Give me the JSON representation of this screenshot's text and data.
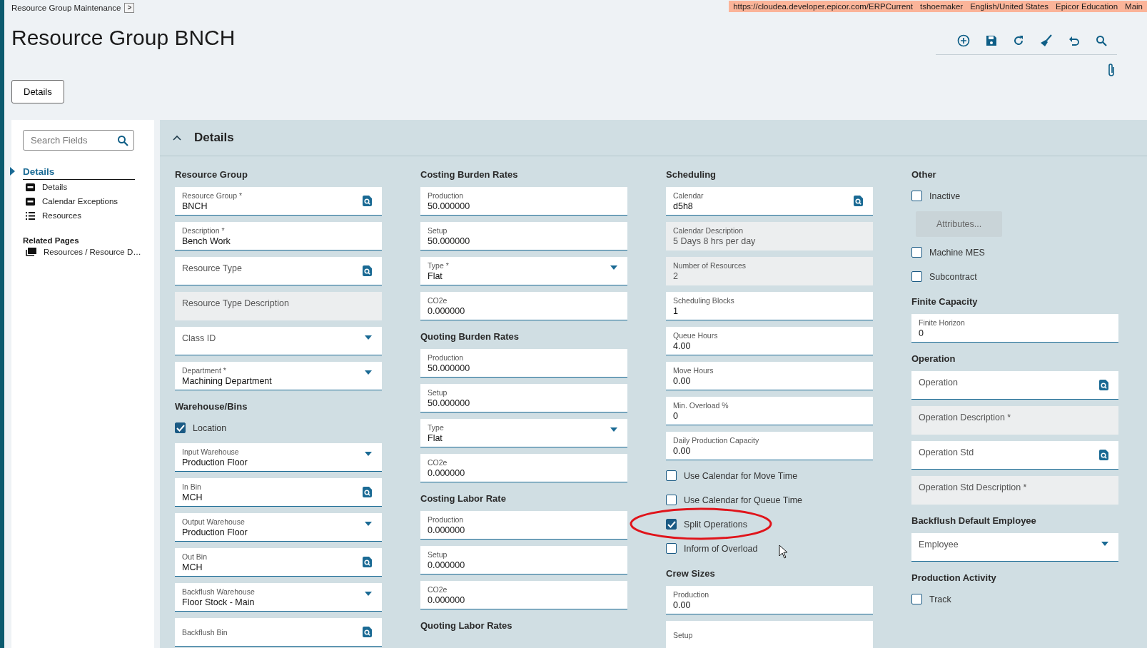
{
  "breadcrumb": {
    "label": "Resource Group Maintenance",
    "chevron": ">"
  },
  "session_bar": [
    "https://cloudea.developer.epicor.com/ERPCurrent",
    "tshoemaker",
    "English/United States",
    "Epicor Education",
    "Main"
  ],
  "title": "Resource Group BNCH",
  "tabs": [
    {
      "label": "Details",
      "selected": true
    }
  ],
  "sidebar": {
    "search": {
      "placeholder": "Search Fields"
    },
    "sections": [
      {
        "label": "Details",
        "selected": true,
        "expanded": true,
        "children": [
          {
            "label": "Details",
            "kind": "form"
          },
          {
            "label": "Calendar Exceptions",
            "kind": "form"
          },
          {
            "label": "Resources",
            "kind": "list"
          }
        ]
      }
    ],
    "related_heading": "Related Pages",
    "related": [
      {
        "label": "Resources / Resource D…"
      }
    ]
  },
  "panel": {
    "title": "Details",
    "expanded": true
  },
  "columns": [
    [
      {
        "kind": "heading",
        "label": "Resource Group"
      },
      {
        "kind": "lookup_field",
        "label": "Resource Group *",
        "value": "BNCH",
        "readonly": false
      },
      {
        "kind": "text_field",
        "label": "Description *",
        "value": "Bench Work",
        "readonly": false
      },
      {
        "kind": "lookup_field",
        "label": "Resource Type",
        "readonly": false
      },
      {
        "kind": "text_field",
        "label": "Resource Type Description",
        "readonly": true
      },
      {
        "kind": "dropdown_field",
        "label": "Class ID",
        "readonly": false
      },
      {
        "kind": "dropdown_field",
        "label": "Department *",
        "value": "Machining Department",
        "readonly": false
      },
      {
        "kind": "heading",
        "label": "Warehouse/Bins"
      },
      {
        "kind": "checkbox",
        "label": "Location",
        "checked": true,
        "highlighted": false
      },
      {
        "kind": "dropdown_field",
        "label": "Input Warehouse",
        "value": "Production Floor",
        "readonly": false
      },
      {
        "kind": "lookup_field",
        "label": "In Bin",
        "value": "MCH",
        "readonly": false
      },
      {
        "kind": "dropdown_field",
        "label": "Output Warehouse",
        "value": "Production Floor",
        "readonly": false
      },
      {
        "kind": "lookup_field",
        "label": "Out Bin",
        "value": "MCH",
        "readonly": false
      },
      {
        "kind": "dropdown_field",
        "label": "Backflush Warehouse",
        "value": "Floor Stock - Main",
        "readonly": false
      },
      {
        "kind": "clipped_lookup_field",
        "label": "Backflush Bin",
        "readonly": false
      }
    ],
    [
      {
        "kind": "heading",
        "label": "Costing Burden Rates"
      },
      {
        "kind": "text_field",
        "label": "Production",
        "value": "50.000000",
        "readonly": false
      },
      {
        "kind": "text_field",
        "label": "Setup",
        "value": "50.000000",
        "readonly": false
      },
      {
        "kind": "dropdown_field",
        "label": "Type *",
        "value": "Flat",
        "readonly": false
      },
      {
        "kind": "text_field",
        "label": "CO2e",
        "value": "0.000000",
        "readonly": false
      },
      {
        "kind": "heading",
        "label": "Quoting Burden Rates"
      },
      {
        "kind": "text_field",
        "label": "Production",
        "value": "50.000000",
        "readonly": false
      },
      {
        "kind": "text_field",
        "label": "Setup",
        "value": "50.000000",
        "readonly": false
      },
      {
        "kind": "dropdown_field",
        "label": "Type",
        "value": "Flat",
        "readonly": false
      },
      {
        "kind": "text_field",
        "label": "CO2e",
        "value": "0.000000",
        "readonly": false
      },
      {
        "kind": "heading",
        "label": "Costing Labor Rate"
      },
      {
        "kind": "text_field",
        "label": "Production",
        "value": "0.000000",
        "readonly": false
      },
      {
        "kind": "text_field",
        "label": "Setup",
        "value": "0.000000",
        "readonly": false
      },
      {
        "kind": "text_field",
        "label": "CO2e",
        "value": "0.000000",
        "readonly": false
      },
      {
        "kind": "heading",
        "label": "Quoting Labor Rates"
      }
    ],
    [
      {
        "kind": "heading",
        "label": "Scheduling"
      },
      {
        "kind": "lookup_field",
        "label": "Calendar",
        "value": "d5h8",
        "readonly": false
      },
      {
        "kind": "text_field",
        "label": "Calendar Description",
        "value": "5 Days 8 hrs per day",
        "readonly": true
      },
      {
        "kind": "text_field",
        "label": "Number of Resources",
        "value": "2",
        "readonly": true
      },
      {
        "kind": "text_field",
        "label": "Scheduling Blocks",
        "value": "1",
        "readonly": false
      },
      {
        "kind": "text_field",
        "label": "Queue Hours",
        "value": "4.00",
        "readonly": false
      },
      {
        "kind": "text_field",
        "label": "Move Hours",
        "value": "0.00",
        "readonly": false
      },
      {
        "kind": "text_field",
        "label": "Min. Overload %",
        "value": "0",
        "readonly": false
      },
      {
        "kind": "text_field",
        "label": "Daily Production Capacity",
        "value": "0.00",
        "readonly": false
      },
      {
        "kind": "checkbox",
        "label": "Use Calendar for Move Time",
        "checked": false,
        "highlighted": false
      },
      {
        "kind": "checkbox",
        "label": "Use Calendar for Queue Time",
        "checked": false,
        "highlighted": false
      },
      {
        "kind": "checkbox",
        "label": "Split Operations",
        "checked": true,
        "highlighted": true
      },
      {
        "kind": "checkbox",
        "label": "Inform of Overload",
        "checked": false,
        "highlighted": false
      },
      {
        "kind": "heading",
        "label": "Crew Sizes"
      },
      {
        "kind": "text_field",
        "label": "Production",
        "value": "0.00",
        "readonly": false
      },
      {
        "kind": "clipped_text_field",
        "label": "Setup",
        "readonly": false
      }
    ],
    [
      {
        "kind": "heading",
        "label": "Other"
      },
      {
        "kind": "checkbox",
        "label": "Inactive",
        "checked": false,
        "highlighted": false
      },
      {
        "kind": "button",
        "label": "Attributes...",
        "disabled": true
      },
      {
        "kind": "checkbox",
        "label": "Machine MES",
        "checked": false,
        "highlighted": false
      },
      {
        "kind": "checkbox",
        "label": "Subcontract",
        "checked": false,
        "highlighted": false
      },
      {
        "kind": "heading",
        "label": "Finite Capacity"
      },
      {
        "kind": "text_field",
        "label": "Finite Horizon",
        "value": "0",
        "readonly": false
      },
      {
        "kind": "heading",
        "label": "Operation"
      },
      {
        "kind": "lookup_field",
        "label": "Operation",
        "readonly": false
      },
      {
        "kind": "text_field",
        "label": "Operation Description *",
        "readonly": true
      },
      {
        "kind": "lookup_field",
        "label": "Operation Std",
        "readonly": false
      },
      {
        "kind": "text_field",
        "label": "Operation Std Description *",
        "readonly": true
      },
      {
        "kind": "heading",
        "label": "Backflush Default Employee"
      },
      {
        "kind": "dropdown_field",
        "label": "Employee",
        "readonly": false
      },
      {
        "kind": "heading",
        "label": "Production Activity"
      },
      {
        "kind": "checkbox",
        "label": "Track",
        "checked": false,
        "highlighted": false
      }
    ]
  ]
}
